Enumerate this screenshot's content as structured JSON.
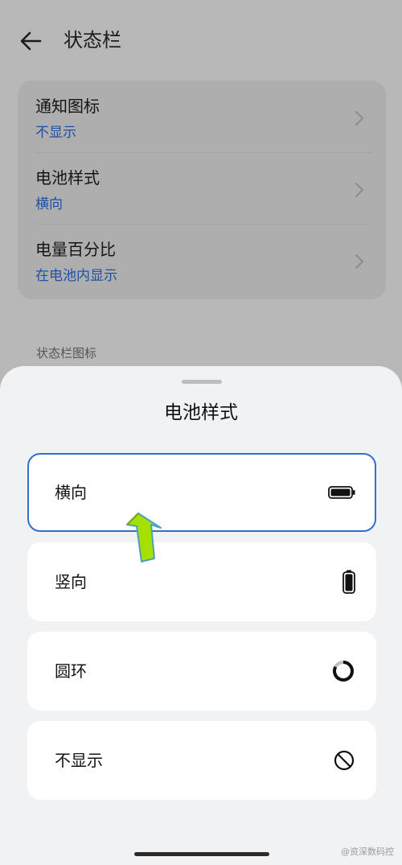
{
  "header": {
    "title": "状态栏"
  },
  "settings": [
    {
      "title": "通知图标",
      "value": "不显示"
    },
    {
      "title": "电池样式",
      "value": "横向"
    },
    {
      "title": "电量百分比",
      "value": "在电池内显示"
    }
  ],
  "section_label": "状态栏图标",
  "sheet": {
    "title": "电池样式",
    "options": [
      {
        "label": "横向",
        "selected": true,
        "icon": "battery-horizontal-icon"
      },
      {
        "label": "竖向",
        "selected": false,
        "icon": "battery-vertical-icon"
      },
      {
        "label": "圆环",
        "selected": false,
        "icon": "battery-ring-icon"
      },
      {
        "label": "不显示",
        "selected": false,
        "icon": "hidden-icon"
      }
    ]
  },
  "watermark": "@资深数码控",
  "colors": {
    "accent": "#2f6fd0",
    "link": "#1f4fa8",
    "arrow": "#a6e000"
  }
}
